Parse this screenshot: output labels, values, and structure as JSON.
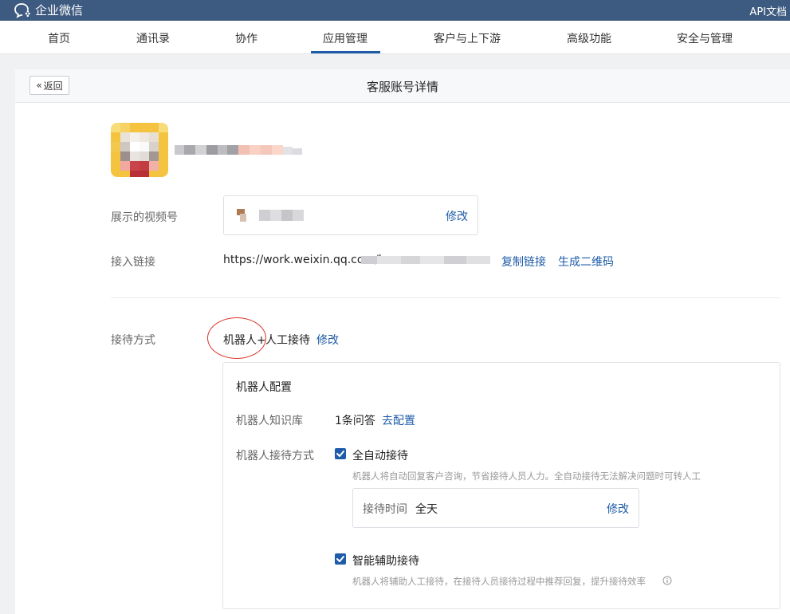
{
  "app": {
    "logo_text": "企业微信",
    "api_doc": "API文档"
  },
  "nav": {
    "items": [
      "首页",
      "通讯录",
      "协作",
      "应用管理",
      "客户与上下游",
      "高级功能",
      "安全与管理"
    ],
    "active": "应用管理"
  },
  "panel": {
    "back_label": "返回",
    "title": "客服账号详情"
  },
  "account": {
    "video_label": "展示的视频号",
    "video_edit": "修改",
    "link_label": "接入链接",
    "link_prefix": "https://work.weixin.qq.com/k",
    "copy_link": "复制链接",
    "gen_qr": "生成二维码"
  },
  "reception": {
    "label": "接待方式",
    "value_a": "机器人+",
    "value_b": "人工接待",
    "edit": "修改"
  },
  "robot": {
    "title": "机器人配置",
    "kb_label": "机器人知识库",
    "kb_value": "1条问答",
    "kb_link": "去配置",
    "mode_label": "机器人接待方式",
    "auto": {
      "label": "全自动接待",
      "checked": true,
      "hint": "机器人将自动回复客户咨询，节省接待人员人力。全自动接待无法解决问题时可转人工"
    },
    "time": {
      "label": "接待时间",
      "value": "全天",
      "edit": "修改"
    },
    "assist": {
      "label": "智能辅助接待",
      "checked": true,
      "hint": "机器人将辅助人工接待，在接待人员接待过程中推荐回复，提升接待效率"
    }
  },
  "colors": {
    "topbar": "#3d5a80",
    "accent": "#1e5ba8",
    "annotation": "#d9342b"
  }
}
